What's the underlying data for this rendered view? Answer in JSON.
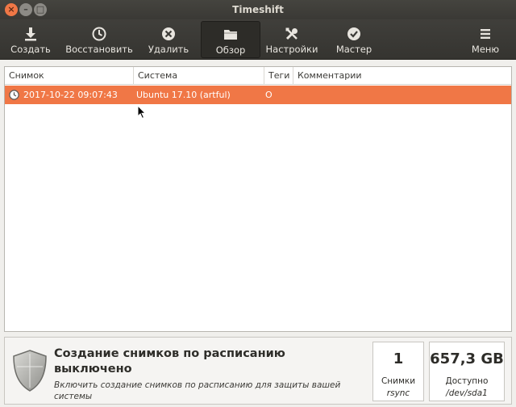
{
  "window": {
    "title": "Timeshift"
  },
  "toolbar": {
    "create": {
      "label": "Создать",
      "icon": "download-icon"
    },
    "restore": {
      "label": "Восстановить",
      "icon": "clock-icon"
    },
    "delete": {
      "label": "Удалить",
      "icon": "delete-icon"
    },
    "browse": {
      "label": "Обзор",
      "icon": "folder-icon"
    },
    "settings": {
      "label": "Настройки",
      "icon": "tools-icon"
    },
    "wizard": {
      "label": "Мастер",
      "icon": "check-icon"
    },
    "menu": {
      "label": "Меню",
      "icon": "hamburger-icon"
    }
  },
  "table": {
    "columns": [
      "Снимок",
      "Система",
      "Теги",
      "Комментарии"
    ],
    "rows": [
      {
        "snapshot": "2017-10-22 09:07:43",
        "system": "Ubuntu 17.10 (artful)",
        "tags": "O",
        "comments": "",
        "selected": true
      }
    ]
  },
  "status": {
    "title": "Создание снимков по расписанию выключено",
    "subtitle": "Включить создание снимков по расписанию для защиты вашей системы",
    "snapshots": {
      "value": "1",
      "label": "Снимки",
      "sub": "rsync"
    },
    "available": {
      "value": "657,3 GB",
      "label": "Доступно",
      "sub": "/dev/sda1"
    }
  },
  "colors": {
    "accent": "#F07746",
    "toolbar": "#3C3B37"
  }
}
